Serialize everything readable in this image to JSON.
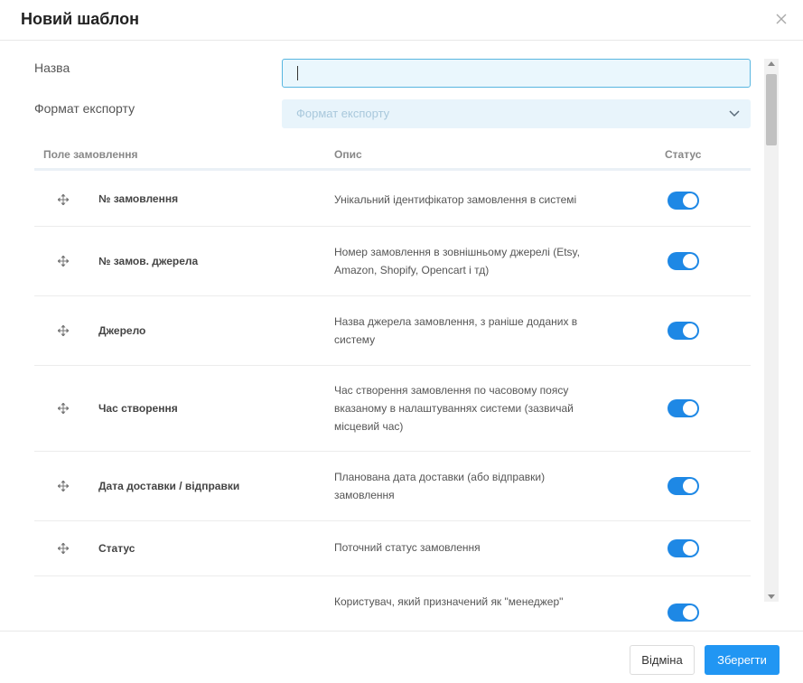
{
  "dialog": {
    "title": "Новий шаблон",
    "close_icon": "close-icon"
  },
  "form": {
    "name_label": "Назва",
    "name_value": "",
    "format_label": "Формат експорту",
    "format_placeholder": "Формат експорту"
  },
  "table": {
    "headers": [
      "Поле замовлення",
      "Опис",
      "Статус"
    ],
    "rows": [
      {
        "field": "№ замовлення",
        "description": "Унікальний ідентифікатор замовлення в системі",
        "status": true
      },
      {
        "field": "№ замов. джерела",
        "description": "Номер замовлення в зовнішньому джерелі (Etsy, Amazon, Shopify, Opencart і тд)",
        "status": true
      },
      {
        "field": "Джерело",
        "description": "Назва джерела замовлення, з раніше доданих в систему",
        "status": true
      },
      {
        "field": "Час створення",
        "description": "Час створення замовлення по часовому поясу вказаному в налаштуваннях системи (зазвичай місцевий час)",
        "status": true
      },
      {
        "field": "Дата доставки / відправки",
        "description": "Планована дата доставки (або відправки) замовлення",
        "status": true
      },
      {
        "field": "Статус",
        "description": "Поточний статус замовлення",
        "status": true
      },
      {
        "field": "",
        "description": "Користувач, який призначений як \"менеджер\"",
        "status": true
      }
    ]
  },
  "footer": {
    "cancel_label": "Відміна",
    "save_label": "Зберегти"
  },
  "colors": {
    "accent": "#2196f3",
    "toggle_on": "#1e88e5",
    "input_focus_border": "#58b6e0"
  }
}
